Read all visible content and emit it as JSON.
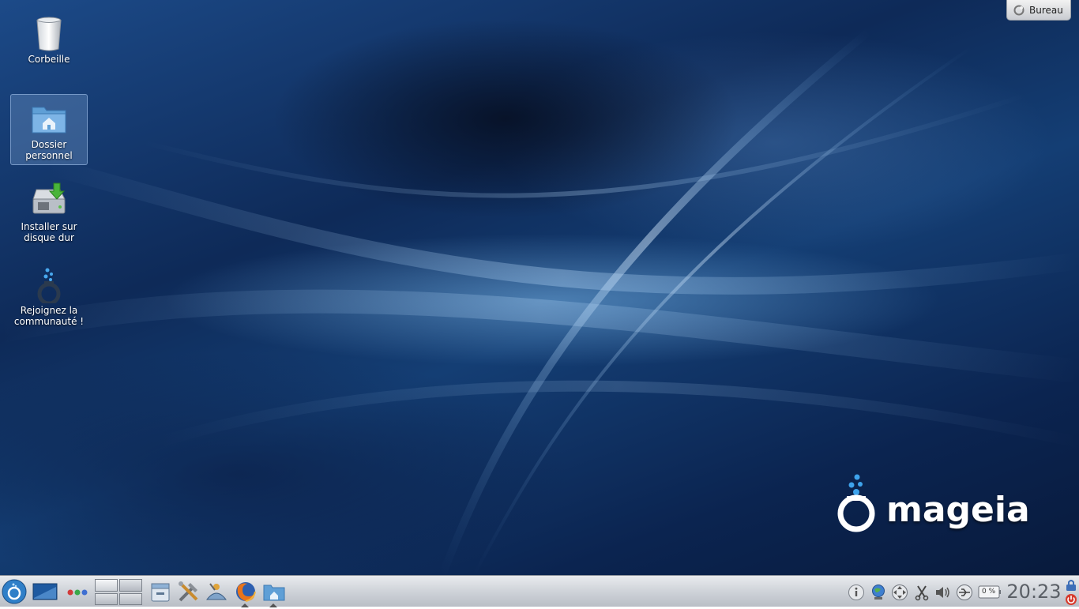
{
  "desktop": {
    "icons": [
      {
        "label": "Corbeille",
        "icon": "trash-icon"
      },
      {
        "label": "Dossier personnel",
        "icon": "home-folder-icon",
        "selected": true
      },
      {
        "label": "Installer sur disque dur",
        "icon": "install-disk-icon"
      },
      {
        "label": "Rejoignez la communauté !",
        "icon": "mageia-community-icon"
      }
    ],
    "cashew_button": {
      "label": "Bureau"
    },
    "brand": {
      "wordmark": "mageia"
    }
  },
  "taskbar": {
    "launchers": [
      "application-menu-icon",
      "show-desktop-icon",
      "activities-icon",
      "file-manager-icon",
      "system-settings-icon",
      "control-center-icon",
      "firefox-icon",
      "dolphin-home-icon"
    ],
    "pager": {
      "desktops": 4,
      "active": 1
    },
    "tray": [
      "info-icon",
      "network-icon",
      "device-notifier-icon",
      "klipper-icon",
      "volume-icon",
      "usb-icon",
      "battery-icon"
    ],
    "battery_text": "0 %",
    "clock": "20:23",
    "panel_tools": [
      "lock-icon",
      "logout-icon"
    ]
  },
  "colors": {
    "wallpaper_dark": "#081a3c",
    "wallpaper_mid": "#143e74",
    "wallpaper_glow": "#78b4e6",
    "panel": "#cfd3d9",
    "clock_text": "#5a5f66",
    "mageia_blue": "#2f8fd8"
  }
}
